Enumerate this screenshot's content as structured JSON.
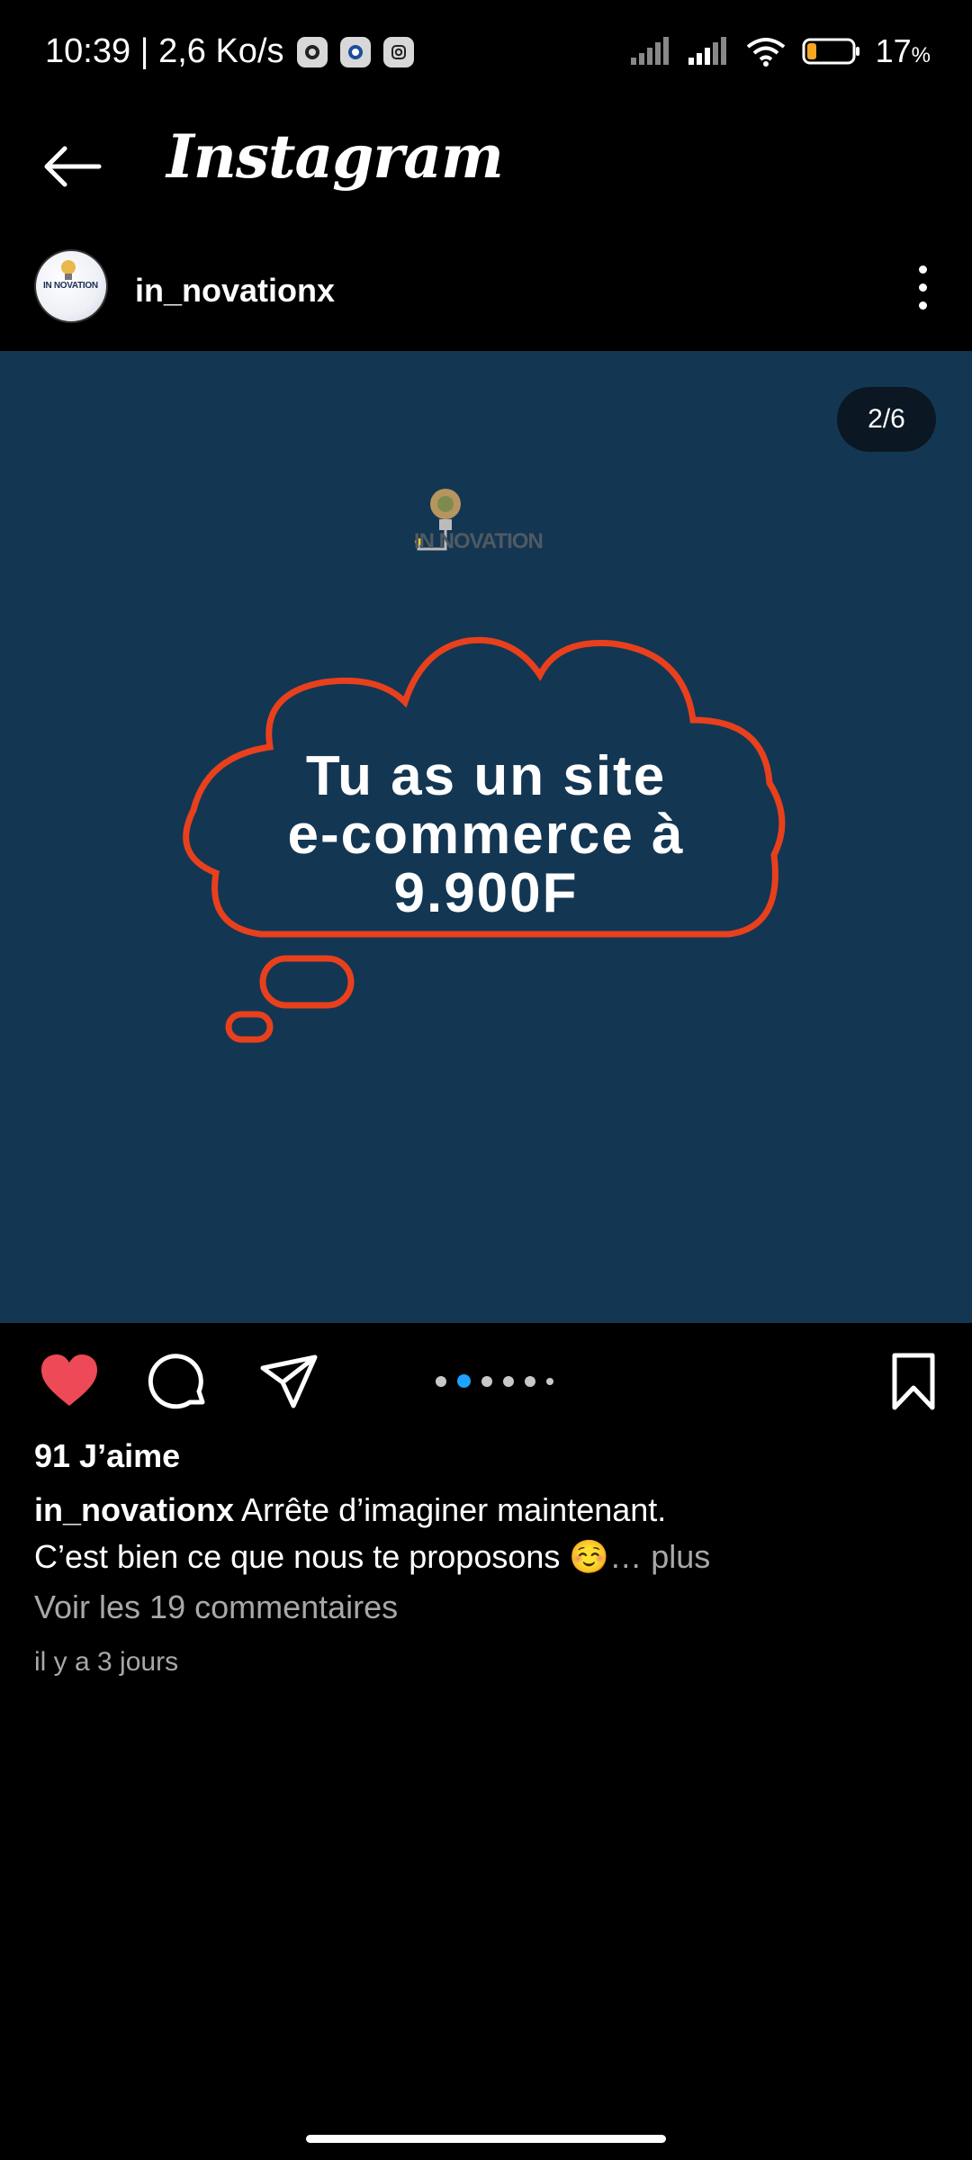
{
  "status_bar": {
    "time": "10:39 | 2,6 Ko/s",
    "battery_percent": "17",
    "battery_unit": "%",
    "notification_icons": [
      "whatsapp-icon",
      "messenger-icon",
      "instagram-icon"
    ],
    "signal_icons": [
      "signal-icon",
      "signal-icon",
      "wifi-icon",
      "battery-icon"
    ]
  },
  "header": {
    "title": "Instagram"
  },
  "post": {
    "username": "in_novationx",
    "avatar_text": "IN NOVATION",
    "slide_counter": "2/6",
    "current_slide": 2,
    "total_slides": 6,
    "image": {
      "background_color": "#133653",
      "accent_color": "#e8401c",
      "brand_text": "IN NOVATION",
      "headline_lines": [
        "Tu as un site",
        "e-commerce à",
        "9.900F"
      ]
    },
    "likes": "91 J’aime",
    "caption_user": "in_novationx",
    "caption_line1": "Arrête d’imaginer maintenant.",
    "caption_line2": "C’est bien ce que nous te proposons ☺️",
    "caption_more": "… plus",
    "view_comments": "Voir les 19 commentaires",
    "time_ago": "il y a 3 jours",
    "liked": true,
    "like_color": "#ed4956"
  },
  "colors": {
    "background": "#000000",
    "secondary_text": "#a8a8a8",
    "carousel_active": "#1fa1ff"
  }
}
